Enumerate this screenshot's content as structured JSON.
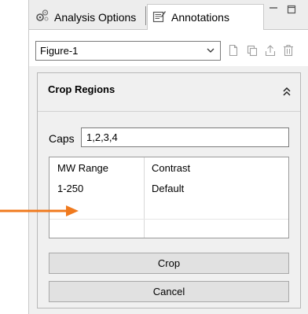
{
  "tabs": [
    {
      "label": "Analysis Options",
      "icon": "gear-cluster-icon",
      "active": false
    },
    {
      "label": "Annotations",
      "icon": "annotation-editor-icon",
      "active": true
    }
  ],
  "figure": {
    "selected": "Figure-1",
    "actions": [
      "new-document-icon",
      "duplicate-icon",
      "export-upload-icon",
      "delete-trash-icon"
    ]
  },
  "crop_regions": {
    "title": "Crop Regions",
    "caps_label": "Caps",
    "caps_value": "1,2,3,4",
    "table": {
      "columns": [
        "MW Range",
        "Contrast"
      ],
      "rows": [
        [
          "1-250",
          "Default"
        ],
        [
          "",
          ""
        ],
        [
          "",
          ""
        ]
      ]
    },
    "crop_button": "Crop",
    "cancel_button": "Cancel"
  },
  "colors": {
    "annotation_arrow": "#f07a1e",
    "panel_bg": "#f0f0f0",
    "button_bg": "#e1e1e1"
  }
}
